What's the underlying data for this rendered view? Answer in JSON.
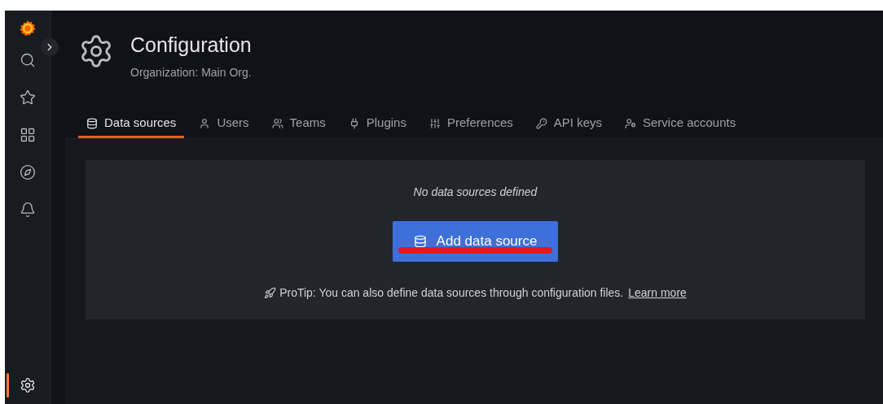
{
  "sidebar": {
    "items": [
      {
        "selected": false
      },
      {
        "selected": false
      },
      {
        "selected": false
      },
      {
        "selected": false
      },
      {
        "selected": false
      }
    ],
    "bottom_item": {
      "selected": true
    }
  },
  "header": {
    "title": "Configuration",
    "subtitle": "Organization: Main Org."
  },
  "tabs": [
    {
      "label": "Data sources",
      "selected": true
    },
    {
      "label": "Users",
      "selected": false
    },
    {
      "label": "Teams",
      "selected": false
    },
    {
      "label": "Plugins",
      "selected": false
    },
    {
      "label": "Preferences",
      "selected": false
    },
    {
      "label": "API keys",
      "selected": false
    },
    {
      "label": "Service accounts",
      "selected": false
    }
  ],
  "empty_state": {
    "message": "No data sources defined",
    "button": "Add data source",
    "protip": "ProTip: You can also define data sources through configuration files.",
    "link": "Learn more"
  }
}
